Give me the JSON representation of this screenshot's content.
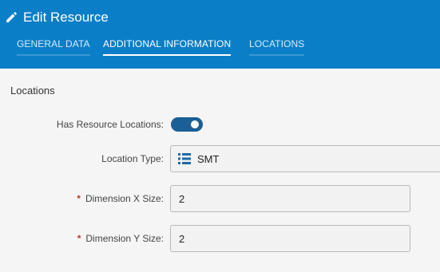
{
  "header": {
    "title": "Edit Resource",
    "icon": "pencil-icon",
    "tabs": [
      {
        "label": "GENERAL DATA",
        "active": false
      },
      {
        "label": "ADDITIONAL INFORMATION",
        "active": true
      },
      {
        "label": "LOCATIONS",
        "active": false
      }
    ]
  },
  "section": {
    "title": "Locations"
  },
  "form": {
    "has_locations_label": "Has Resource Locations:",
    "has_locations_value": true,
    "location_type_label": "Location Type:",
    "location_type_value": "SMT",
    "location_type_icon": "list-icon",
    "required_marker": "*",
    "dim_x_label": "Dimension X Size:",
    "dim_x_value": "2",
    "dim_y_label": "Dimension Y Size:",
    "dim_y_value": "2"
  },
  "colors": {
    "header_bg": "#0a7fc7",
    "toggle_on": "#1b5f97",
    "required": "#c0392b",
    "list_icon": "#1b6aa8"
  }
}
